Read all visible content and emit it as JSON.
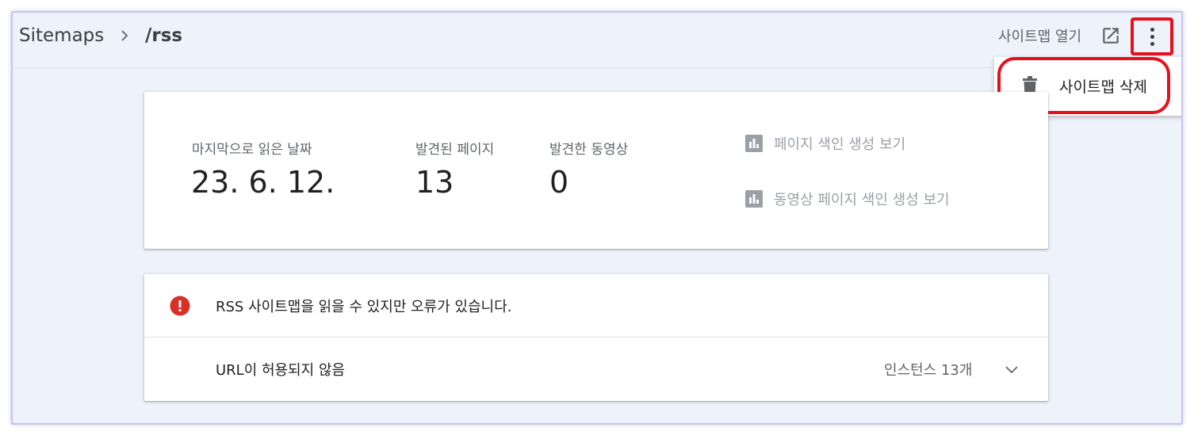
{
  "header": {
    "breadcrumb_root": "Sitemaps",
    "breadcrumb_current": "/rss",
    "open_sitemap_label": "사이트맵 열기"
  },
  "menu": {
    "delete_label": "사이트맵 삭제"
  },
  "stats": {
    "last_read_label": "마지막으로 읽은 날짜",
    "last_read_value": "23. 6. 12.",
    "pages_found_label": "발견된 페이지",
    "pages_found_value": "13",
    "videos_found_label": "발견한 동영상",
    "videos_found_value": "0"
  },
  "reports": {
    "page_indexing": "페이지 색인 생성 보기",
    "video_indexing": "동영상 페이지 색인 생성 보기"
  },
  "error": {
    "message": "RSS 사이트맵을 읽을 수 있지만 오류가 있습니다."
  },
  "issue": {
    "title": "URL이 허용되지 않음",
    "count": "인스턴스 13개"
  },
  "colors": {
    "background": "#eef2fa",
    "error_red": "#d93025",
    "highlight_red": "#e8101a",
    "disabled_gray": "#9aa0a6"
  }
}
